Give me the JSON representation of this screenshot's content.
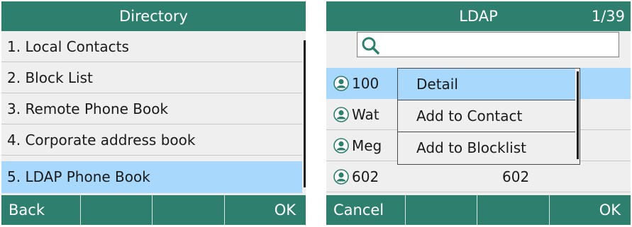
{
  "left_screen": {
    "title": "Directory",
    "items": [
      {
        "label": "1. Local Contacts"
      },
      {
        "label": "2. Block List"
      },
      {
        "label": "3. Remote Phone Book"
      },
      {
        "label": "4. Corporate address book"
      },
      {
        "label": "5. LDAP Phone Book",
        "selected": true
      }
    ],
    "softkeys": [
      "Back",
      "",
      "",
      "OK"
    ]
  },
  "right_screen": {
    "title": "LDAP",
    "counter": "1/39",
    "search": {
      "value": "",
      "placeholder": ""
    },
    "contacts": [
      {
        "name": "100",
        "number": "",
        "selected": true
      },
      {
        "name": "Wat",
        "number": ""
      },
      {
        "name": "Meg",
        "number": ""
      },
      {
        "name": "602",
        "number": "602"
      }
    ],
    "popup_menu": {
      "items": [
        {
          "label": "Detail",
          "selected": true
        },
        {
          "label": "Add to Contact"
        },
        {
          "label": "Add to Blocklist"
        }
      ]
    },
    "softkeys": [
      "Cancel",
      "",
      "",
      "OK"
    ]
  },
  "colors": {
    "bar": "#2f7f6e",
    "selection": "#a8d8fb",
    "background": "#efefef",
    "icon_accent": "#2f7f6e"
  },
  "icons": {
    "search": "search-icon",
    "contact": "contact-icon"
  }
}
